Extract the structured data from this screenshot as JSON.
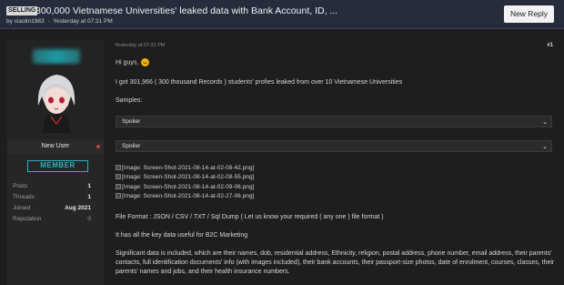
{
  "header": {
    "tag": "SELLING",
    "title": "300,000 Vietnamese Universities' leaked data with Bank Account, ID, ...",
    "by_prefix": "by",
    "author": "xiaolin1983",
    "separator": "·",
    "posted": "Yesterday at 07:31 PM",
    "new_reply_label": "New Reply"
  },
  "user_panel": {
    "title": "New User",
    "badge": "MEMBER",
    "stats": [
      {
        "label": "Posts",
        "value": "1"
      },
      {
        "label": "Threads",
        "value": "1"
      },
      {
        "label": "Joined",
        "value": "Aug 2021"
      },
      {
        "label": "Reputation",
        "value": "0"
      }
    ]
  },
  "post": {
    "date": "Yesterday at 07:31 PM",
    "number": "#1",
    "greeting": "Hi guys,",
    "intro": "I got 301,966 ( 300 thousand Records ) students' profies leaked from over 10 Vietnamese Universities",
    "samples_label": "Samples:",
    "spoilers": [
      "Spoiler",
      "Spoiler"
    ],
    "spoiler_chevron": "⌄",
    "images": [
      "[Image: Screen-Shot-2021-08-14-at-02-08-42.png]",
      "[Image: Screen-Shot-2021-08-14-at-02-08-55.png]",
      "[Image: Screen-Shot-2021-08-14-at-02-09-06.png]",
      "[Image: Screen-Shot-2021-08-14-at-02-27-06.png]"
    ],
    "file_format": "File Format :  JSON  / CSV / TXT / Sql Dump  ( Let us know your required ( any one ) file format )",
    "key_data": "It has all the key data useful for B2C Marketing",
    "significant": "Significant data is included, which are their names, dob, residential address, Ethnicity, religion, postal address, phone number, email address, their parents' contacts, full identification documents' info (with images included), their bank accounts, their passport-size photos, date of enrolment, courses, classes, their parents' names and jobs, and their health insurance numbers."
  },
  "colors": {
    "accent": "#2bb3c0",
    "header_bg": "#262c3b",
    "status_dot": "#c53d3d"
  }
}
